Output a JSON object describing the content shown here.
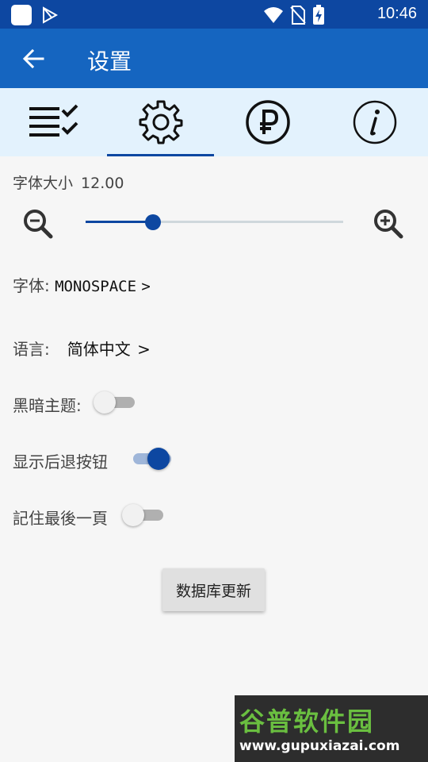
{
  "status_bar": {
    "time": "10:46"
  },
  "app_bar": {
    "title": "设置"
  },
  "tabs": [
    {
      "icon": "checklist-icon"
    },
    {
      "icon": "gear-icon",
      "active": true
    },
    {
      "icon": "ruble-icon"
    },
    {
      "icon": "info-icon"
    }
  ],
  "font_size": {
    "label": "字体大小",
    "value": "12.00",
    "slider_fraction": 0.26
  },
  "font": {
    "label": "字体:",
    "value": "MONOSPACE",
    "arrow": ">"
  },
  "language": {
    "label": "语言:",
    "value": "简体中文",
    "arrow": ">"
  },
  "dark_theme": {
    "label": "黑暗主题:",
    "enabled": false
  },
  "show_back_button": {
    "label": "显示后退按钮",
    "enabled": true
  },
  "remember_last_page": {
    "label": "記住最後一頁",
    "enabled": false
  },
  "update_button": {
    "label": "数据库更新"
  },
  "watermark": {
    "title": "谷普软件园",
    "url": "www.gupuxiazai.com"
  },
  "colors": {
    "status_bar": "#0d47a1",
    "app_bar": "#1565c0",
    "tab_bar": "#e3f2fd",
    "accent": "#0d47a1"
  }
}
